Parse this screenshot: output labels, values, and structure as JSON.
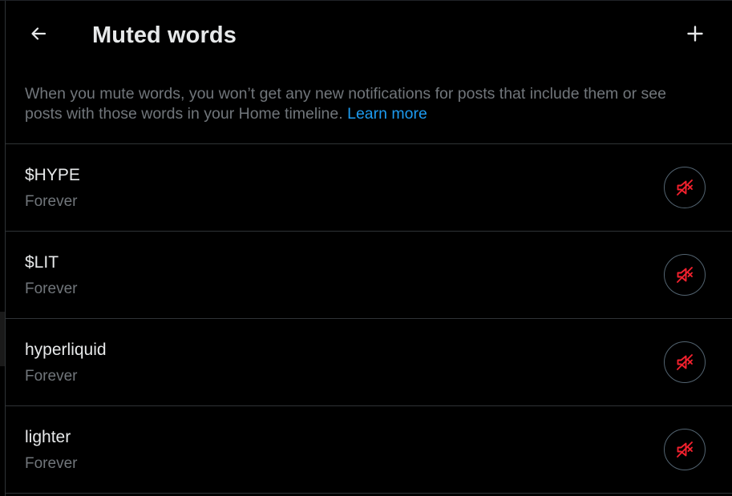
{
  "header": {
    "title": "Muted words",
    "back_icon": "arrow-left-icon",
    "add_icon": "plus-icon"
  },
  "description": {
    "text": "When you mute words, you won’t get any new notifications for posts that include them or see posts with those words in your Home timeline.",
    "link_label": "Learn more"
  },
  "muted_words": [
    {
      "word": "$HYPE",
      "duration": "Forever"
    },
    {
      "word": "$LIT",
      "duration": "Forever"
    },
    {
      "word": "hyperliquid",
      "duration": "Forever"
    },
    {
      "word": "lighter",
      "duration": "Forever"
    }
  ],
  "unmute_icon": "speaker-muted-icon",
  "colors": {
    "background": "#000000",
    "text_primary": "#e7e9ea",
    "text_secondary": "#71767b",
    "link": "#1d9bf0",
    "danger": "#f4212e",
    "divider": "#2f3336"
  }
}
